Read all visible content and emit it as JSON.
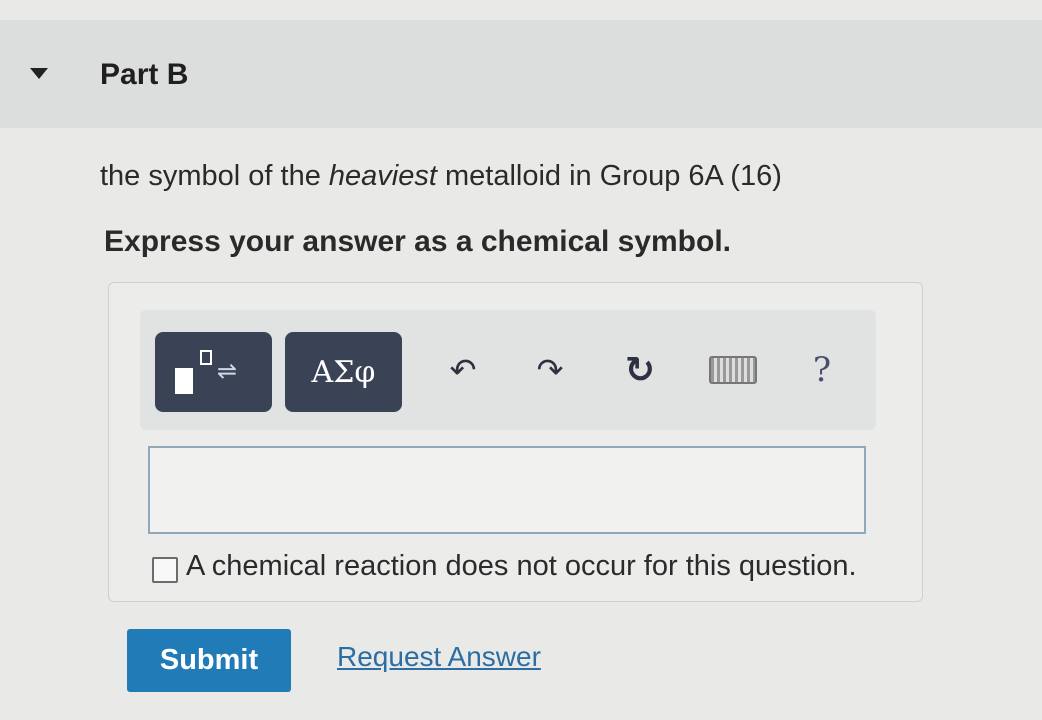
{
  "part": {
    "title": "Part B"
  },
  "question": {
    "before": "the symbol of the ",
    "emphasis": "heaviest",
    "after": " metalloid in Group 6A (16)"
  },
  "instruction": "Express your answer as a chemical symbol.",
  "toolbar": {
    "greek_label": "ΑΣφ",
    "undo_glyph": "↶",
    "redo_glyph": "↷",
    "reset_glyph": "↻",
    "help_label": "?",
    "template_arrows": "⇌"
  },
  "answer": {
    "value": ""
  },
  "checkbox": {
    "label": "A chemical reaction does not occur for this question."
  },
  "actions": {
    "submit_label": "Submit",
    "request_label": "Request Answer"
  },
  "colors": {
    "submit": "#217bb7",
    "toolbar_button": "#3a4356",
    "link": "#2c6da3"
  }
}
